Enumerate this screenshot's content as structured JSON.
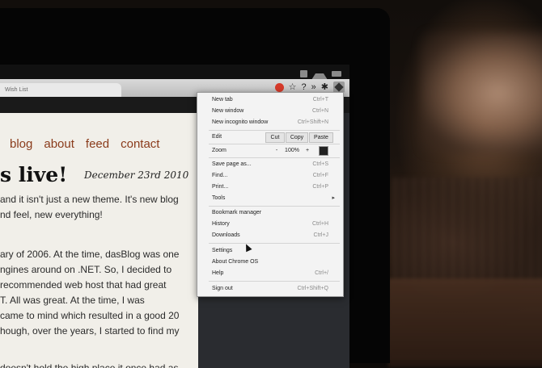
{
  "browser": {
    "tab_label": "Wish List"
  },
  "page": {
    "nav": [
      "blog",
      "about",
      "feed",
      "contact"
    ],
    "post_title": "s live!",
    "post_date": "December 23rd 2010",
    "para1": [
      "and it isn't just a new theme. It's new blog",
      "nd feel, new everything!"
    ],
    "para2": [
      "ary of 2006. At the time, dasBlog was one",
      "ngines around on .NET. So, I decided to",
      "recommended web host that had great",
      "T. All was great. At the time, I was",
      "came to mind which resulted in a good 20",
      "hough, over the years, I started to find my"
    ],
    "para3": "doesn't hold the high place it once had as"
  },
  "menu": {
    "new_tab": "New tab",
    "new_tab_sc": "Ctrl+T",
    "new_window": "New window",
    "new_window_sc": "Ctrl+N",
    "new_incognito": "New incognito window",
    "new_incognito_sc": "Ctrl+Shift+N",
    "edit": "Edit",
    "cut": "Cut",
    "copy": "Copy",
    "paste": "Paste",
    "zoom": "Zoom",
    "zoom_minus": "-",
    "zoom_level": "100%",
    "zoom_plus": "+",
    "save_page": "Save page as...",
    "save_page_sc": "Ctrl+S",
    "find": "Find...",
    "find_sc": "Ctrl+F",
    "print": "Print...",
    "print_sc": "Ctrl+P",
    "tools": "Tools",
    "bookmark_manager": "Bookmark manager",
    "history": "History",
    "history_sc": "Ctrl+H",
    "downloads": "Downloads",
    "downloads_sc": "Ctrl+J",
    "settings": "Settings",
    "about": "About Chrome OS",
    "help": "Help",
    "help_sc": "Ctrl+/",
    "sign_out": "Sign out",
    "sign_out_sc": "Ctrl+Shift+Q"
  },
  "icons": [
    "stop-icon",
    "star-icon",
    "question-icon",
    "chevron-right-icon",
    "puzzle-icon",
    "wrench-icon",
    "wifi-icon",
    "battery-icon"
  ]
}
